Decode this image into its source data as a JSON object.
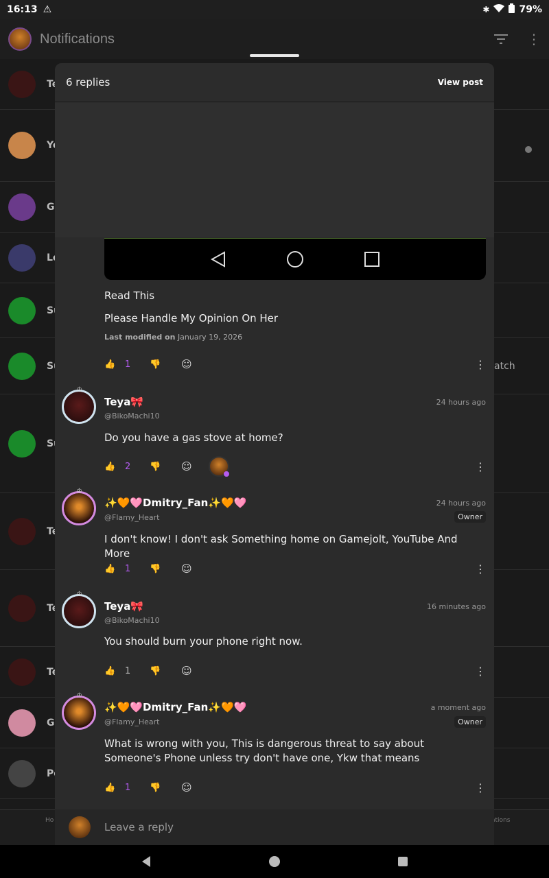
{
  "status_bar": {
    "time": "16:13",
    "battery": "79%"
  },
  "app_bar": {
    "title": "Notifications"
  },
  "background": {
    "rows": [
      {
        "letter": "Te",
        "color": "#3a1515"
      },
      {
        "letter": "Yo",
        "color": "#c8854a"
      },
      {
        "letter": "G",
        "color": "#6a3a8a"
      },
      {
        "letter": "Lo",
        "color": "#3a3a6a"
      },
      {
        "letter": "Su",
        "color": "#1a8a2a"
      },
      {
        "letter": "Su",
        "color": "#1a8a2a"
      },
      {
        "letter": "Su",
        "color": "#1a8a2a"
      },
      {
        "letter": "Te",
        "color": "#3a1515"
      },
      {
        "letter": "Te",
        "color": "#3a1515"
      },
      {
        "letter": "Te",
        "color": "#3a1515"
      },
      {
        "letter": "G",
        "color": "#d08aa0"
      },
      {
        "letter": "Po",
        "color": "#444444"
      }
    ],
    "side_text_1": "atch",
    "nav_left": "Ho",
    "nav_right": "ations"
  },
  "sheet": {
    "reply_count": "6 replies",
    "view_post": "View post"
  },
  "post": {
    "line1": "Read This",
    "line2": "Please Handle My Opinion On Her",
    "modified_label": "Last modified on",
    "modified_date": "January 19, 2026",
    "likes": "1"
  },
  "comments": [
    {
      "name": "Teya🎀",
      "handle": "@BikoMachi10",
      "time": "24 hours ago",
      "owner": "",
      "body": "Do you have a gas stove at home?",
      "likes": "2",
      "liked": true
    },
    {
      "name": "✨🧡🩷Dmitry_Fan✨🧡🩷",
      "handle": "@Flamy_Heart",
      "time": "24 hours ago",
      "owner": "Owner",
      "body": "I don't know! I don't ask Something home on Gamejolt, YouTube And More",
      "likes": "1",
      "liked": true
    },
    {
      "name": "Teya🎀",
      "handle": "@BikoMachi10",
      "time": "16 minutes ago",
      "owner": "",
      "body": "You should burn your phone right now.",
      "likes": "1",
      "liked": false
    },
    {
      "name": "✨🧡🩷Dmitry_Fan✨🧡🩷",
      "handle": "@Flamy_Heart",
      "time": "a moment ago",
      "owner": "Owner",
      "body": "What is wrong with you, This is dangerous threat to say about Someone's Phone unless try don't have one, Ykw that means",
      "likes": "1",
      "liked": true
    }
  ],
  "reply": {
    "placeholder": "Leave a reply"
  },
  "colors": {
    "accent": "#b45cf0",
    "sheet": "#2b2b2b"
  }
}
